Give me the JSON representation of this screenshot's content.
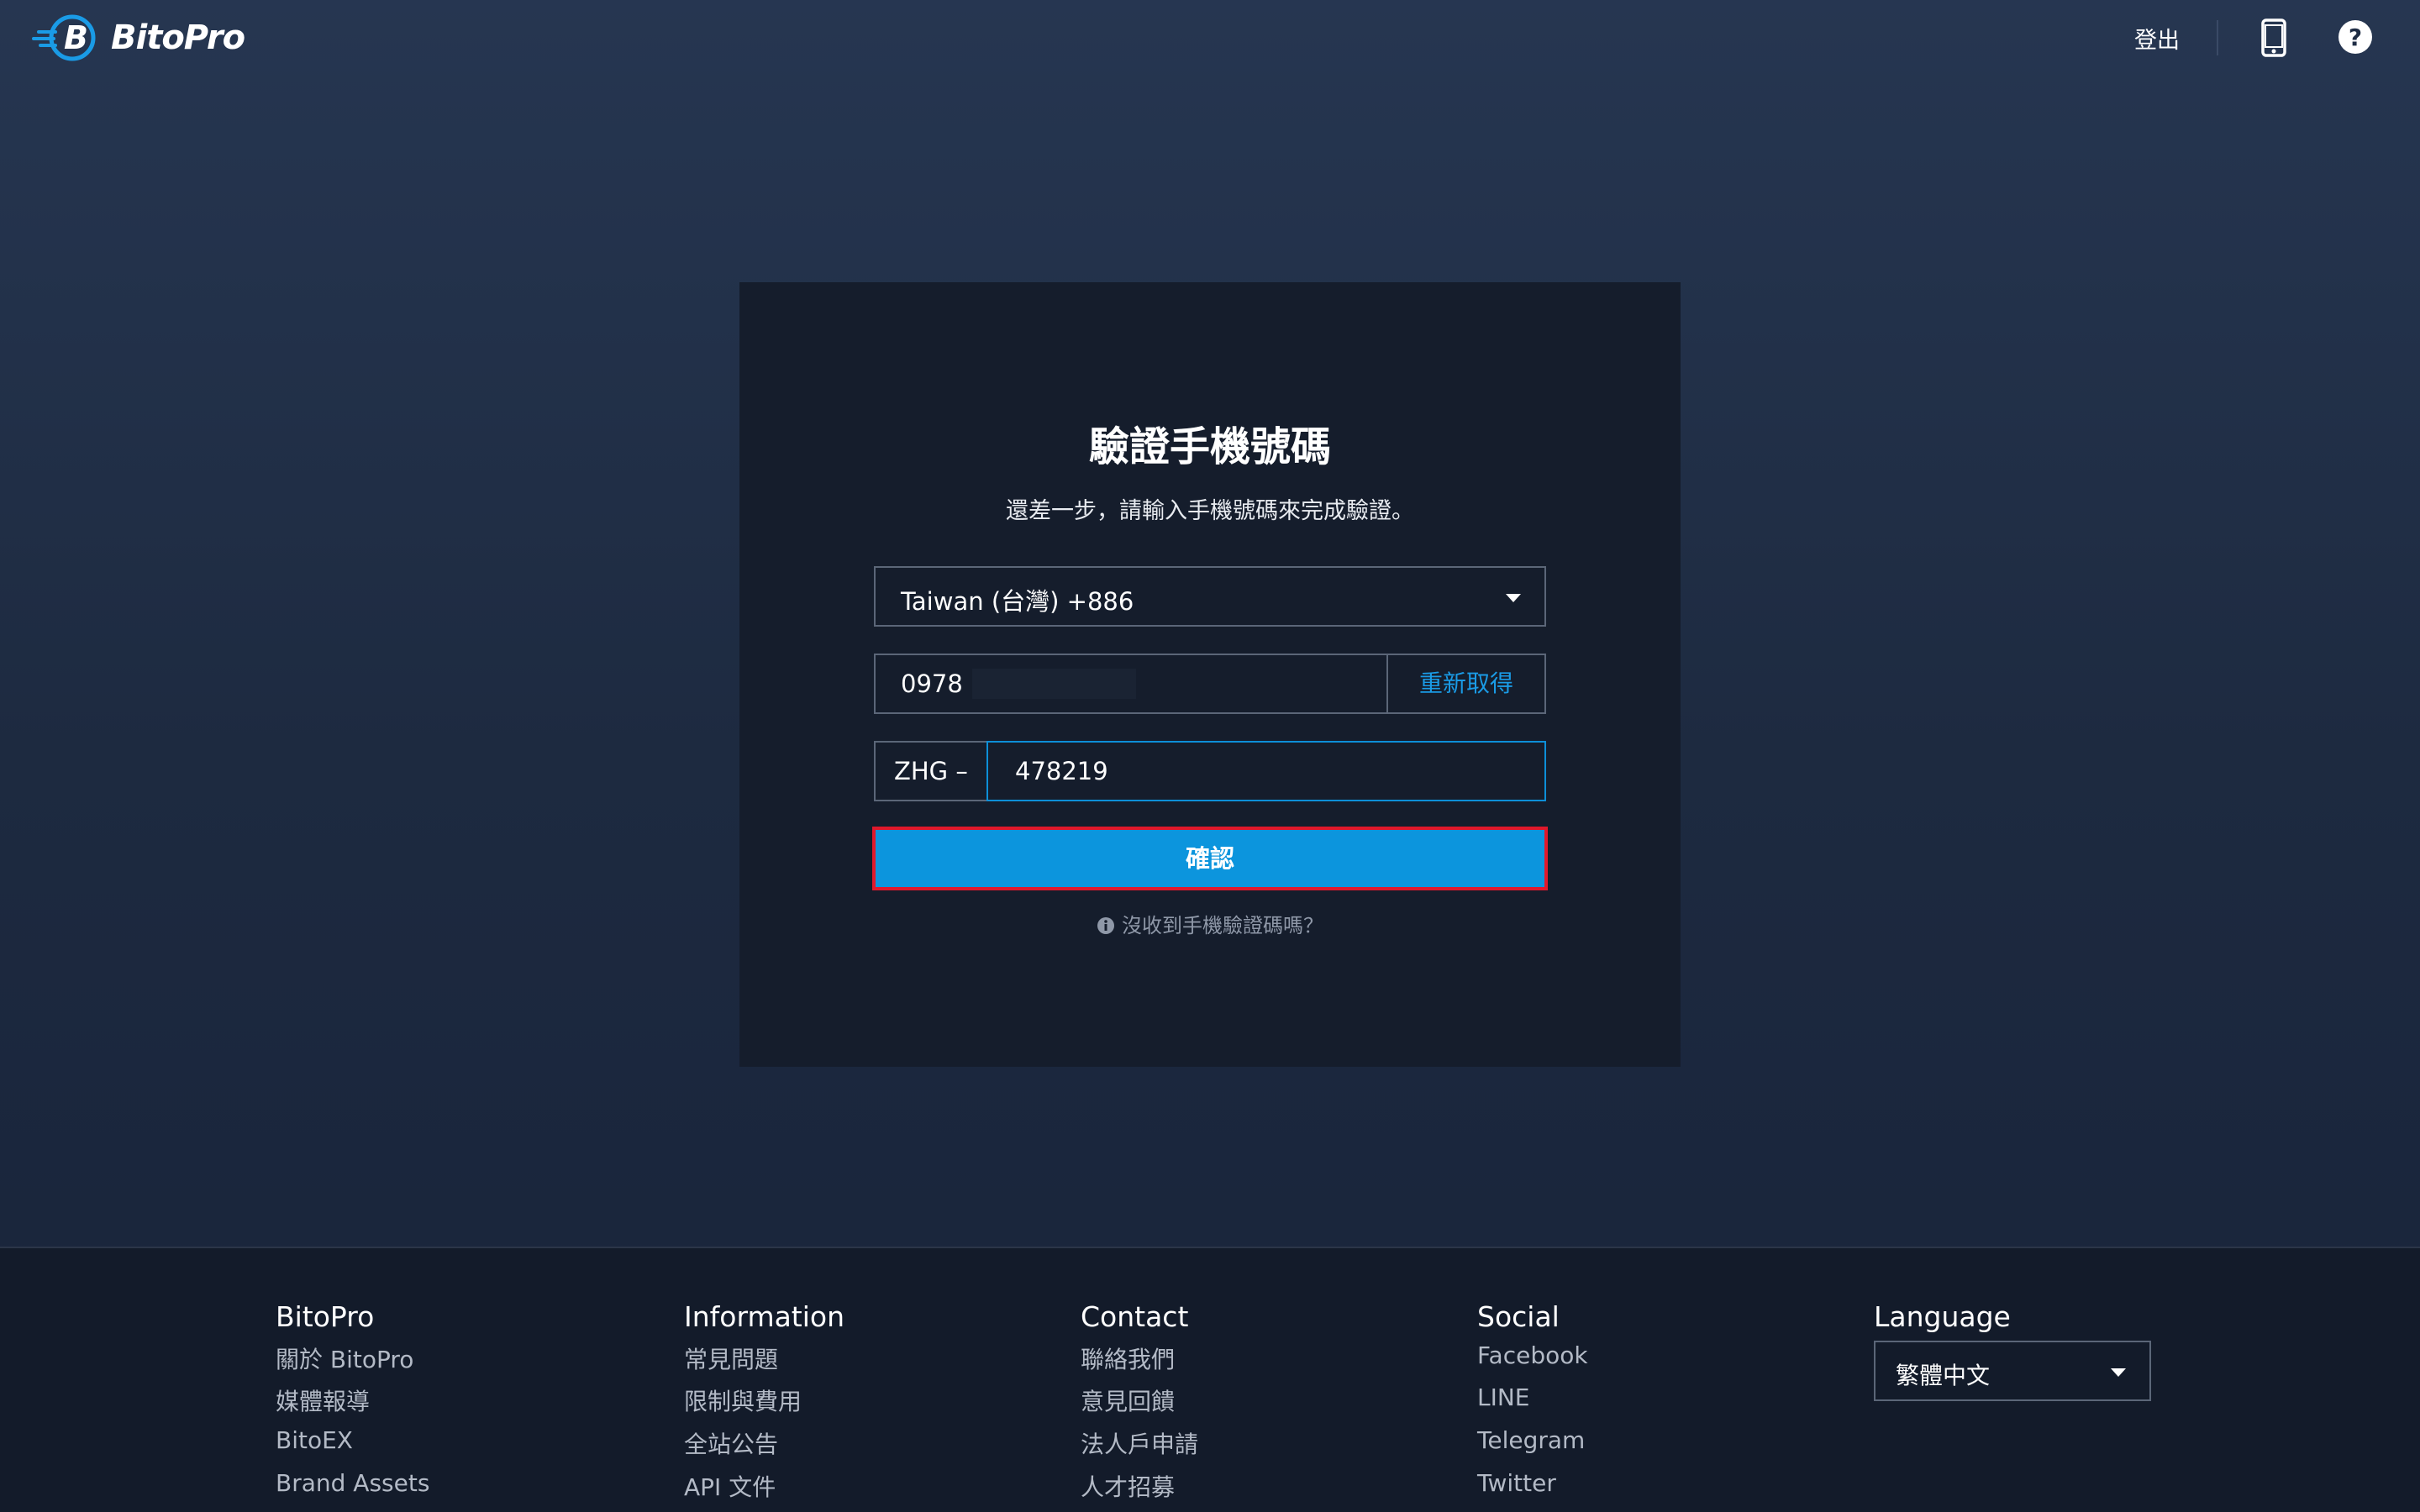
{
  "header": {
    "brand": "BitoPro",
    "logout_label": "登出",
    "icons": {
      "phone": "mobile-phone-icon",
      "help": "help-question-icon"
    }
  },
  "verify": {
    "title": "驗證手機號碼",
    "subtitle": "還差一步，請輸入手機號碼來完成驗證。",
    "country_value": "Taiwan (台灣) +886",
    "phone_value": "0978",
    "resend_label": "重新取得",
    "code_prefix": "ZHG –",
    "code_value": "478219",
    "confirm_label": "確認",
    "help_text": "沒收到手機驗證碼嗎？"
  },
  "footer": {
    "columns": [
      {
        "heading": "BitoPro",
        "links": [
          "關於 BitoPro",
          "媒體報導",
          "BitoEX",
          "Brand Assets"
        ]
      },
      {
        "heading": "Information",
        "links": [
          "常見問題",
          "限制與費用",
          "全站公告",
          "API 文件"
        ]
      },
      {
        "heading": "Contact",
        "links": [
          "聯絡我們",
          "意見回饋",
          "法人戶申請",
          "人才招募"
        ]
      },
      {
        "heading": "Social",
        "links": [
          "Facebook",
          "LINE",
          "Telegram",
          "Twitter"
        ]
      }
    ],
    "language": {
      "heading": "Language",
      "selected": "繁體中文"
    }
  },
  "colors": {
    "accent": "#0c95dd",
    "link": "#1a9be6",
    "focus_outline": "#e0182b"
  }
}
